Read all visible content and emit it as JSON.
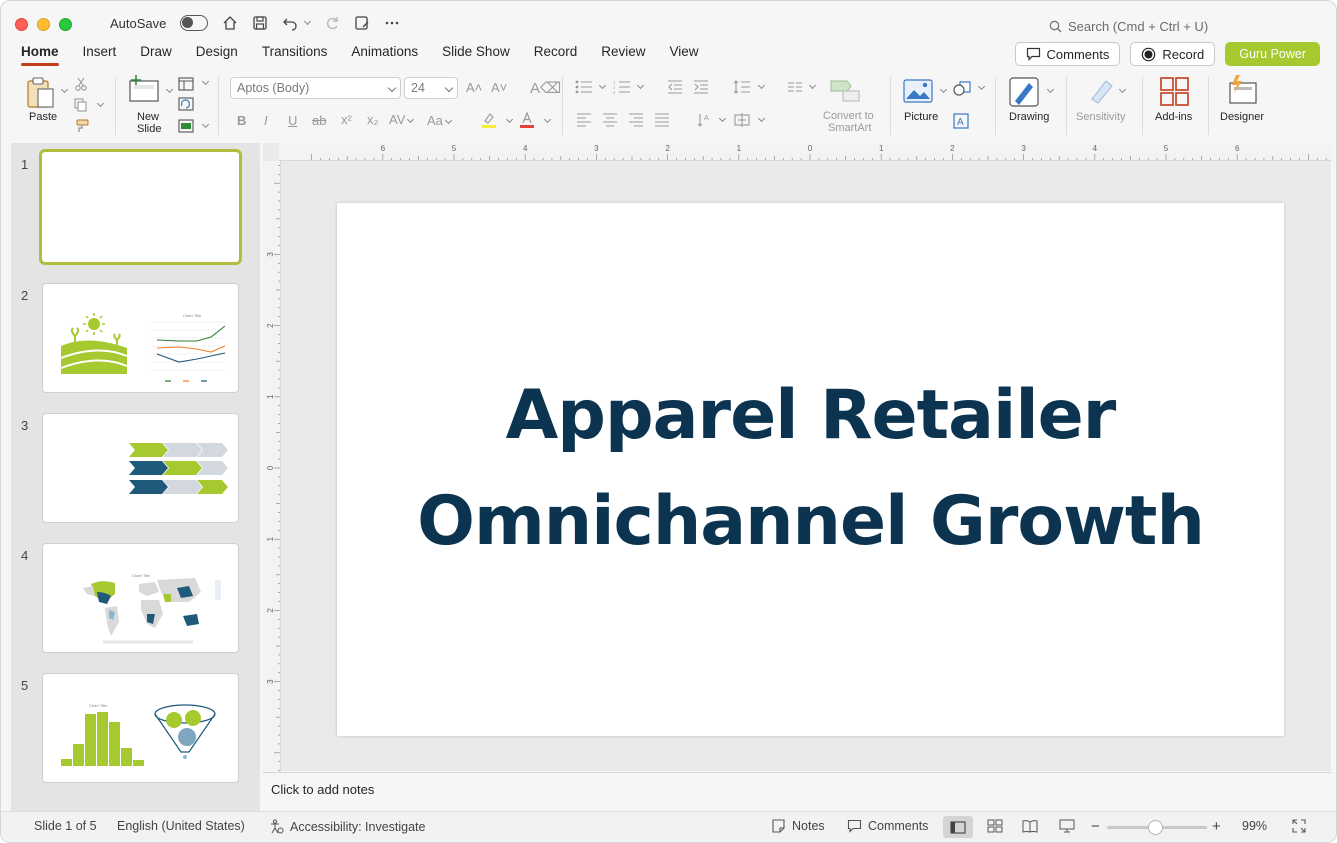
{
  "titlebar": {
    "autosave_label": "AutoSave",
    "search_placeholder": "Search (Cmd + Ctrl + U)"
  },
  "tabs": [
    "Home",
    "Insert",
    "Draw",
    "Design",
    "Transitions",
    "Animations",
    "Slide Show",
    "Record",
    "Review",
    "View"
  ],
  "top_right": {
    "comments": "Comments",
    "record": "Record",
    "guru": "Guru Power"
  },
  "ribbon": {
    "paste": "Paste",
    "new_slide_1": "New",
    "new_slide_2": "Slide",
    "font_name": "Aptos (Body)",
    "font_size": "24",
    "convert_1": "Convert to",
    "convert_2": "SmartArt",
    "picture": "Picture",
    "drawing": "Drawing",
    "sensitivity": "Sensitivity",
    "addins": "Add-ins",
    "designer": "Designer"
  },
  "thumbnails": [
    {
      "num": "1"
    },
    {
      "num": "2"
    },
    {
      "num": "3"
    },
    {
      "num": "4"
    },
    {
      "num": "5"
    }
  ],
  "rulers": {
    "h_ticks": [
      "6",
      "5",
      "4",
      "3",
      "2",
      "1",
      "0",
      "1",
      "2",
      "3",
      "4",
      "5",
      "6"
    ],
    "v_ticks": [
      "3",
      "2",
      "1",
      "0",
      "1",
      "2",
      "3"
    ]
  },
  "slide": {
    "title_line1": "Apparel Retailer",
    "title_line2": "Omnichannel Growth"
  },
  "notes_placeholder": "Click to add notes",
  "status": {
    "slide_of": "Slide 1 of 5",
    "language": "English (United States)",
    "accessibility": "Accessibility: Investigate",
    "notes": "Notes",
    "comments": "Comments",
    "zoom": "99%"
  },
  "colors": {
    "title": "#0c3450",
    "accent_green": "#a7c930",
    "accent_navy": "#1f5a7a",
    "tab_underline": "#c43e1c"
  }
}
